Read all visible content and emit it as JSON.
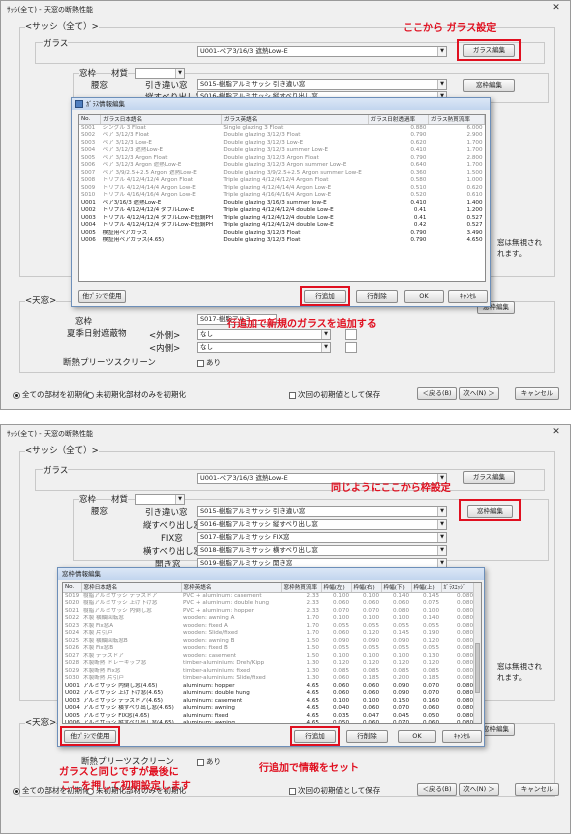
{
  "shot1": {
    "window_title": "ｻｯｼ(全て) - 天窓の断熱性能",
    "sash_group": "<サッシ（全て）>",
    "glass_label": "ガラス",
    "glass_value": "U001-ペア3/16/3 遮熱Low-E",
    "glass_edit_button": "ガラス編集",
    "mado_label": "窓枠",
    "material_label": "材質",
    "koshimado_label": "腰窓",
    "hikichigai_label": "引き違い窓",
    "hikichigai_value": "S015-樹脂アルミサッシ 引き違い窓",
    "tatesuberi_label": "縦すべり出し窓",
    "tatesuberi_value": "S016-樹脂アルミサッシ 縦すべり出し窓",
    "frame_edit_button": "窓枠編集",
    "annotation_top": "ここから ガラス設定",
    "annotation_bottom": "行追加で新規のガラスを追加する",
    "tenmado_group": "<天窓>",
    "mado_label2": "窓枠",
    "mado_value2": "S017-樹脂アルミ...",
    "kaki_label": "夏季日射遮蔽物",
    "soto_label": "<外側>",
    "soto_value": "なし",
    "uchi_label": "<内側>",
    "uchi_value": "なし",
    "pleats_label": "断熱プリーツスクリーン",
    "pleats_check": "あり",
    "radio_all": "全ての部材を初期化",
    "radio_unset": "未初期化部材のみを初期化",
    "save_check": "次回の初期値として保存",
    "back_button": "＜戻る(B)",
    "next_button": "次へ(N) ＞",
    "cancel_button": "キャンセル",
    "side_note1": "窓は無視され",
    "side_note2": "れます。",
    "dialog": {
      "title": "ｶﾞﾗｽ情報編集",
      "headers": [
        "No.",
        "ガラス日本語名",
        "ガラス英語名",
        "ガラス日射透過率",
        "ガラス熱貫流率"
      ],
      "rows": [
        [
          "S001",
          "シングル 3 Float",
          "Single glazing 3 Float",
          "0.880",
          "6.000",
          "g"
        ],
        [
          "S002",
          "ペア 3/12/3 Float",
          "Double glazing 3/12/3 Float",
          "0.790",
          "2.900",
          "g"
        ],
        [
          "S003",
          "ペア 3/12/3 Low-E",
          "Double glazing 3/12/3 Low-E",
          "0.620",
          "1.700",
          "g"
        ],
        [
          "S004",
          "ペア 3/12/3 遮熱Low-E",
          "Double glazing 3/12/3 summer Low-E",
          "0.410",
          "1.700",
          "g"
        ],
        [
          "S005",
          "ペア 3/12/3 Argon Float",
          "Double glazing 3/12/3 Argon Float",
          "0.790",
          "2.800",
          "g"
        ],
        [
          "S006",
          "ペア 3/12/3 Argon 遮熱Low-E",
          "Double glazing 3/12/3 Argon summer Low-E",
          "0.640",
          "1.700",
          "g"
        ],
        [
          "S007",
          "ペア 3/9/2.5+2.5 Argon 遮熱Low-E",
          "Double glazing 3/9/2.5+2.5 Argon summer Low-E",
          "0.360",
          "1.500",
          "g"
        ],
        [
          "S008",
          "トリプル 4/12/4/12/4 Argon Float",
          "Triple glazing 4/12/4/12/4 Argon Float",
          "0.580",
          "1.000",
          "g"
        ],
        [
          "S009",
          "トリプル 4/12/4/14/4 Argon Low-E",
          "Triple glazing 4/12/4/14/4 Argon Low-E",
          "0.510",
          "0.620",
          "g"
        ],
        [
          "S010",
          "トリプル 4/16/4/16/4 Argon Low-E",
          "Triple glazing 4/16/4/16/4 Argon Low-E",
          "0.520",
          "0.610",
          "g"
        ],
        [
          "U001",
          "ペア3/16/3 遮熱Low-E",
          "Double glazing 3/16/3 summer low-E",
          "0.410",
          "1.400",
          "b"
        ],
        [
          "U002",
          "トリプル 4/12/4/12/4 ダブルLow-E",
          "Triple glazing 4/12/4/12/4 double Low-E",
          "0.41",
          "1.200",
          "b"
        ],
        [
          "U003",
          "トリプル 4/12/4/12/4 ダブルLow-E低鋼PH",
          "Triple glazing 4/12/4/12/4 double Low-E",
          "0.41",
          "0.527",
          "b"
        ],
        [
          "U004",
          "トリプル 4/12/4/12/4 ダブルLow-E低鋼PH",
          "Triple glazing 4/12/4/12/4 double Low-E",
          "0.42",
          "0.527",
          "b"
        ],
        [
          "U005",
          "検証用ペアガラス",
          "Double glazing 3/12/3 Float",
          "0.790",
          "3.490",
          "b"
        ],
        [
          "U006",
          "検証用ペアガラス(4.65)",
          "Double glazing 3/12/3 Float",
          "0.790",
          "4.650",
          "b"
        ]
      ],
      "btn_other": "他ﾌﾟﾗﾝで使用",
      "btn_add": "行追加",
      "btn_delete": "行削除",
      "btn_ok": "OK",
      "btn_cancel": "ｷｬﾝｾﾙ"
    }
  },
  "shot2": {
    "window_title": "ｻｯｼ(全て) - 天窓の断熱性能",
    "sash_group": "<サッシ（全て）>",
    "glass_label": "ガラス",
    "glass_value": "U001-ペア3/16/3 遮熱Low-E",
    "glass_edit_button": "ガラス編集",
    "mado_label": "窓枠",
    "material_label": "材質",
    "koshimado_label": "腰窓",
    "hikichigai_label": "引き違い窓",
    "hikichigai_value": "S015-樹脂アルミサッシ 引き違い窓",
    "tatesuberi_label": "縦すべり出し窓",
    "tatesuberi_value": "S016-樹脂アルミサッシ 縦すべり出し窓",
    "fix_label": "FIX窓",
    "fix_value": "S017-樹脂アルミサッシ FIX窓",
    "yokosuberi_label": "横すべり出し窓",
    "yokosuberi_value": "S018-樹脂アルミサッシ 横すべり出し窓",
    "hiraki_label": "開き窓",
    "hiraki_value": "S019-樹脂アルミサッシ 開き窓",
    "frame_edit_button": "窓枠編集",
    "annotation_top": "同じようにここから枠設定",
    "annotation_right": "行追加で情報をセット",
    "annotation_left1": "ガラスと同じですが最後に",
    "annotation_left2": "ここを押して初期設定します",
    "tenmado_group": "<天窓>",
    "pleats_label": "断熱プリーツスクリーン",
    "pleats_check": "あり",
    "radio_all": "全ての部材を初期化",
    "radio_unset": "未初期化部材のみを初期化",
    "save_check": "次回の初期値として保存",
    "back_button": "＜戻る(B)",
    "next_button": "次へ(N) ＞",
    "cancel_button": "キャンセル",
    "side_note1": "窓は無視され",
    "side_note2": "れます。",
    "dialog": {
      "title": "窓枠情報編集",
      "headers": [
        "No.",
        "窓枠日本語名",
        "窓枠英語名",
        "窓枠熱貫流率",
        "枠幅(左)",
        "枠幅(右)",
        "枠幅(下)",
        "枠幅(上)",
        "ｶﾞﾗｽｴｯｼﾞ"
      ],
      "rows": [
        [
          "S019",
          "樹脂アルミサッシ テラスドア",
          "PVC + aluminum: casement",
          "2.33",
          "0.100",
          "0.100",
          "0.140",
          "0.145",
          "0.080",
          "g"
        ],
        [
          "S020",
          "樹脂アルミサッシ 上げ下げ窓",
          "PVC + aluminum: double hung",
          "2.33",
          "0.060",
          "0.060",
          "0.060",
          "0.075",
          "0.080",
          "g"
        ],
        [
          "S021",
          "樹脂アルミサッシ 内倒し窓",
          "PVC + aluminum: hopper",
          "2.33",
          "0.070",
          "0.070",
          "0.080",
          "0.100",
          "0.080",
          "g"
        ],
        [
          "S022",
          "木製 横軸回転窓",
          "wooden: awning A",
          "1.70",
          "0.100",
          "0.100",
          "0.100",
          "0.140",
          "0.080",
          "g"
        ],
        [
          "S023",
          "木製 Fix窓A",
          "wooden: fixed A",
          "1.70",
          "0.055",
          "0.055",
          "0.055",
          "0.055",
          "0.080",
          "g"
        ],
        [
          "S024",
          "木製 片引戸",
          "wooden: Slide/fixed",
          "1.70",
          "0.060",
          "0.120",
          "0.145",
          "0.190",
          "0.080",
          "g"
        ],
        [
          "S025",
          "木製 横軸回転窓B",
          "wooden: awning B",
          "1.50",
          "0.090",
          "0.090",
          "0.090",
          "0.120",
          "0.080",
          "g"
        ],
        [
          "S026",
          "木製 Fix窓B",
          "wooden: fixed B",
          "1.50",
          "0.055",
          "0.055",
          "0.055",
          "0.055",
          "0.080",
          "g"
        ],
        [
          "S027",
          "木製 テラスドア",
          "wooden: casement",
          "1.50",
          "0.100",
          "0.100",
          "0.100",
          "0.130",
          "0.080",
          "g"
        ],
        [
          "S028",
          "木製断熱 ドレーキップ窓",
          "timber-aluminium: Dreh/Kipp",
          "1.30",
          "0.120",
          "0.120",
          "0.120",
          "0.120",
          "0.080",
          "g"
        ],
        [
          "S029",
          "木製断熱 Fix窓",
          "timber-aluminium: fixed",
          "1.30",
          "0.085",
          "0.085",
          "0.085",
          "0.085",
          "0.080",
          "g"
        ],
        [
          "S030",
          "木製断熱 片引戸",
          "timber-aluminium: Slide/fixed",
          "1.30",
          "0.060",
          "0.185",
          "0.200",
          "0.185",
          "0.080",
          "g"
        ],
        [
          "U001",
          "アルミサッシ 内倒し窓(4.65)",
          "aluminum: hopper",
          "4.65",
          "0.060",
          "0.060",
          "0.090",
          "0.070",
          "0.080",
          "b"
        ],
        [
          "U002",
          "アルミサッシ 上げ下げ窓(4.65)",
          "aluminum: double hung",
          "4.65",
          "0.060",
          "0.060",
          "0.090",
          "0.070",
          "0.080",
          "b"
        ],
        [
          "U003",
          "アルミサッシ テラスドア(4.65)",
          "aluminum: casement",
          "4.65",
          "0.100",
          "0.100",
          "0.150",
          "0.160",
          "0.080",
          "b"
        ],
        [
          "U004",
          "アルミサッシ 横すべり出し窓(4.65)",
          "aluminum: awning",
          "4.65",
          "0.040",
          "0.060",
          "0.070",
          "0.060",
          "0.080",
          "b"
        ],
        [
          "U005",
          "アルミサッシ FIX窓(4.65)",
          "aluminum: fixed",
          "4.65",
          "0.035",
          "0.047",
          "0.045",
          "0.050",
          "0.080",
          "b"
        ],
        [
          "U006",
          "アルミサッシ 縦すべり出し窓(4.65)",
          "aluminum: awning",
          "4.65",
          "0.050",
          "0.060",
          "0.070",
          "0.060",
          "0.080",
          "b"
        ],
        [
          "U007",
          "アルミサッシ 引き違い窓(4.65)",
          "aluminum: double sliding",
          "4.65",
          "0.025",
          "0.050",
          "0.070",
          "0.070",
          "0.080",
          "b"
        ]
      ],
      "btn_other": "他ﾌﾟﾗﾝで使用",
      "btn_add": "行追加",
      "btn_delete": "行削除",
      "btn_ok": "OK",
      "btn_cancel": "ｷｬﾝｾﾙ"
    }
  },
  "colors": {
    "annotation_red": "#e01020",
    "dialog_border": "#6d8fb9"
  },
  "icons": {
    "close": "close-icon",
    "dropdown": "chevron-down-icon",
    "dialog": "table-icon"
  }
}
